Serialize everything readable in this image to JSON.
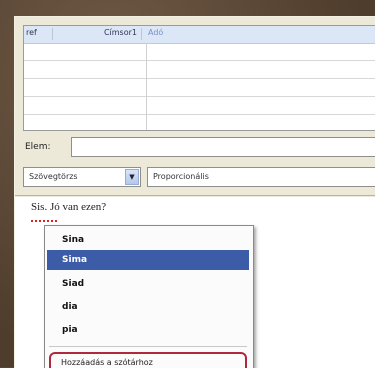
{
  "table": {
    "header": [
      "ref",
      "Címsor1",
      "Adó"
    ],
    "empty_rows": 5
  },
  "label_field": {
    "label": "Elem:",
    "value": ""
  },
  "combos": {
    "left_value": "Szövegtörzs",
    "right_value": "Proporcionális"
  },
  "text": {
    "sample": "Sis. Jó van ezen?"
  },
  "context_menu": {
    "items": [
      "Sina",
      "Sima",
      "Siad",
      "dia",
      "pia"
    ],
    "selected_index": 1,
    "add_to_dictionary": "Hozzáadás a szótárhoz"
  }
}
